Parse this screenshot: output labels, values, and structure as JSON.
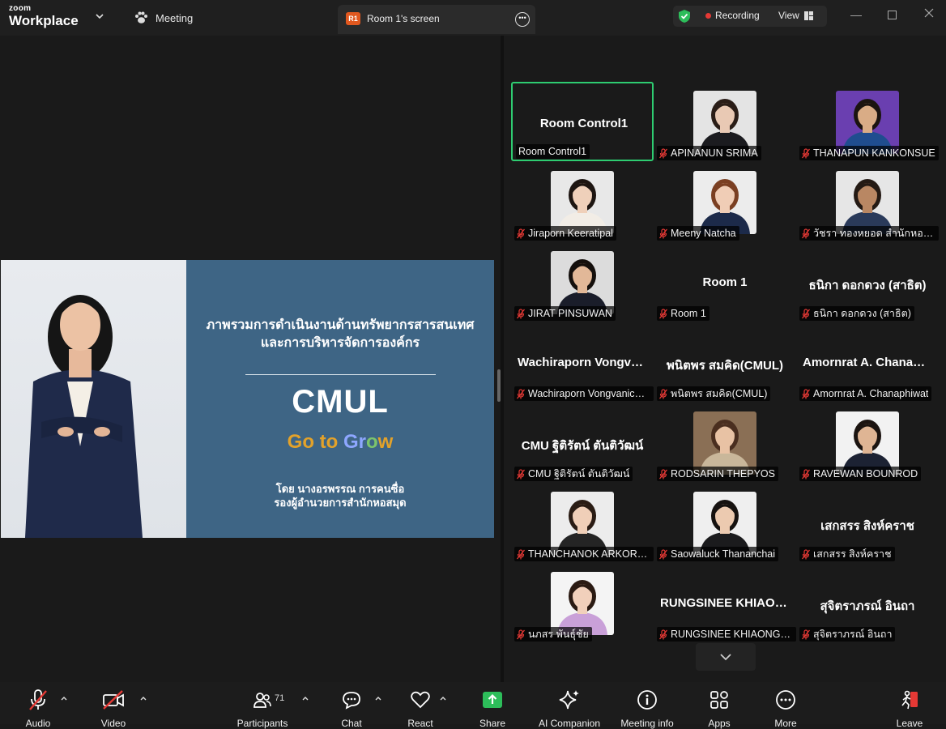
{
  "app": {
    "brand_top": "zoom",
    "brand_bottom": "Workplace",
    "meeting_label": "Meeting"
  },
  "tab": {
    "badge": "R1",
    "title": "Room 1's screen"
  },
  "status": {
    "recording": "Recording",
    "view": "View"
  },
  "slide": {
    "heading_line1": "ภาพรวมการดำเนินงานด้านทรัพยากรสารสนเทศ",
    "heading_line2": "และการบริหารจัดการองค์กร",
    "title": "CMUL",
    "tagline_a": "Go to ",
    "tagline_b": "Gr",
    "tagline_c": "o",
    "tagline_d": "w",
    "presenter_line1": "โดย นางอรพรรณ การคนซื่อ",
    "presenter_line2": "รองผู้อำนวยการสำนักหอสมุด"
  },
  "participants": [
    {
      "display": "Room Control1",
      "tag": "Room Control1",
      "photo": false,
      "muted": false,
      "active": true
    },
    {
      "display": "",
      "tag": "APINANUN SRIMA",
      "photo": true,
      "muted": true,
      "skin": "#e9c9b4",
      "hair": "#2a1d17",
      "top": "#1b1b1f",
      "bg": "#e4e4e4"
    },
    {
      "display": "",
      "tag": "THANAPUN KANKONSUE",
      "photo": true,
      "muted": true,
      "skin": "#d9ac86",
      "hair": "#1b1410",
      "top": "#1f4d8f",
      "bg": "#6a3fb0"
    },
    {
      "display": "",
      "tag": "Jiraporn Keeratipal",
      "photo": true,
      "muted": true,
      "skin": "#efd0ba",
      "hair": "#1d1511",
      "top": "#f2ede6",
      "bg": "#e8e8e8"
    },
    {
      "display": "",
      "tag": "Meeny Natcha",
      "photo": true,
      "muted": true,
      "skin": "#f0cdb6",
      "hair": "#7a3f22",
      "top": "#1c2a4a",
      "bg": "#ececec"
    },
    {
      "display": "",
      "tag": "วัชรา  ทองหยอด สำนักหอสมุด",
      "photo": true,
      "muted": true,
      "skin": "#b98763",
      "hair": "#241a14",
      "top": "#2a3a5a",
      "bg": "#e6e6e6"
    },
    {
      "display": "",
      "tag": "JIRAT PINSUWAN",
      "photo": true,
      "muted": true,
      "skin": "#e2b898",
      "hair": "#140f0c",
      "top": "#1a1d2a",
      "bg": "#dcdcdc"
    },
    {
      "display": "Room 1",
      "tag": "Room 1",
      "photo": false,
      "muted": true
    },
    {
      "display": "ธนิกา ดอกดวง (สาธิต)",
      "tag": "ธนิกา ดอกดวง (สาธิต)",
      "photo": false,
      "muted": true
    },
    {
      "display": "Wachiraporn  Vongvanichphan",
      "tag": "Wachiraporn Vongvanichphan",
      "photo": false,
      "muted": true
    },
    {
      "display": "พนิตพร สมคิด(CMUL)",
      "tag": "พนิตพร สมคิด(CMUL)",
      "photo": false,
      "muted": true
    },
    {
      "display": "Amornrat A. Chanaphiwat",
      "tag": "Amornrat A. Chanaphiwat",
      "photo": false,
      "muted": true
    },
    {
      "display": "CMU ฐิติรัตน์ ตันติวัฒน์",
      "tag": "CMU ฐิติรัตน์ ตันติวัฒน์",
      "photo": false,
      "muted": true
    },
    {
      "display": "",
      "tag": "RODSARIN THEPYOS",
      "photo": true,
      "muted": true,
      "skin": "#e8c2a4",
      "hair": "#4a2e1f",
      "top": "#c9b79a",
      "bg": "#8a6f55"
    },
    {
      "display": "",
      "tag": "RAVEWAN BOUNROD",
      "photo": true,
      "muted": true,
      "skin": "#dfb594",
      "hair": "#1b1410",
      "top": "#1c2233",
      "bg": "#f2f2f2"
    },
    {
      "display": "",
      "tag": "THANCHANOK ARKORNSIRI",
      "photo": true,
      "muted": true,
      "skin": "#f0cfb8",
      "hair": "#2a1c14",
      "top": "#242424",
      "bg": "#ececec"
    },
    {
      "display": "",
      "tag": "Saowaluck Thananchai",
      "photo": true,
      "muted": true,
      "skin": "#eccab0",
      "hair": "#161210",
      "top": "#1b1b1d",
      "bg": "#efefef"
    },
    {
      "display": "เสกสรร สิงห์คราช",
      "tag": "เสกสรร สิงห์คราช",
      "photo": false,
      "muted": true
    },
    {
      "display": "",
      "tag": "นภสร พันธุ์ชัย",
      "photo": true,
      "muted": true,
      "skin": "#f1d0bb",
      "hair": "#2a1a12",
      "top": "#c9a0d8",
      "bg": "#f4f4f4"
    },
    {
      "display": "RUNGSINEE  KHIAONGAM",
      "tag": "RUNGSINEE KHIAONGAM",
      "photo": false,
      "muted": true
    },
    {
      "display": "สุจิตราภรณ์ อินถา",
      "tag": "สุจิตราภรณ์ อินถา",
      "photo": false,
      "muted": true
    }
  ],
  "toolbar": {
    "audio": "Audio",
    "video": "Video",
    "participants": "Participants",
    "participant_count": "71",
    "chat": "Chat",
    "react": "React",
    "share": "Share",
    "ai": "AI Companion",
    "info": "Meeting info",
    "apps": "Apps",
    "more": "More",
    "leave": "Leave"
  },
  "colors": {
    "active_border": "#2ecc71",
    "slide_blue": "#3e6585",
    "share_green": "#2dbd5a",
    "muted_red": "#e53935"
  }
}
